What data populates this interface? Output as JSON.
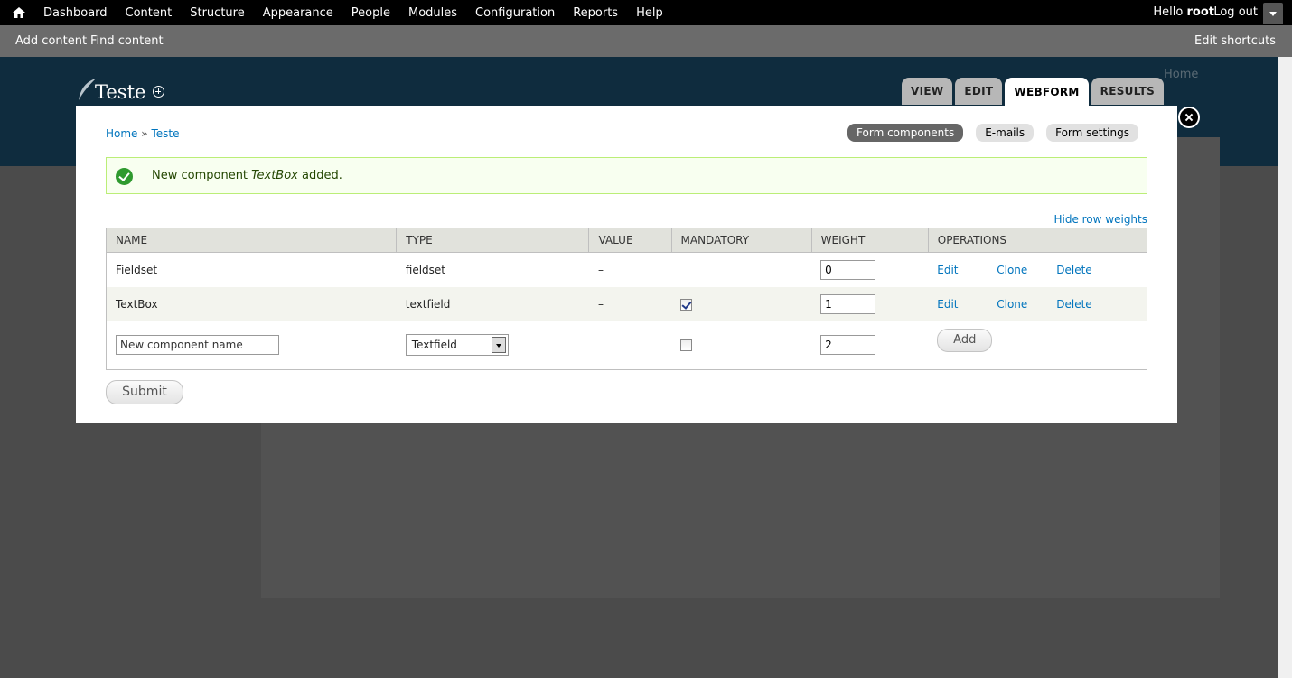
{
  "toolbar": {
    "menu": [
      "Dashboard",
      "Content",
      "Structure",
      "Appearance",
      "People",
      "Modules",
      "Configuration",
      "Reports",
      "Help"
    ],
    "hello": "Hello",
    "username": "root",
    "logout": "Log out"
  },
  "shortcuts": {
    "add_content": "Add content",
    "find_content": "Find content",
    "edit_shortcuts": "Edit shortcuts"
  },
  "site": {
    "title": "Teste",
    "home_link": "Home"
  },
  "tabs": [
    "VIEW",
    "EDIT",
    "WEBFORM",
    "RESULTS"
  ],
  "active_tab": "WEBFORM",
  "breadcrumb": {
    "home": "Home",
    "separator": "»",
    "current": "Teste"
  },
  "subtabs": [
    "Form components",
    "E-mails",
    "Form settings"
  ],
  "active_subtab": "Form components",
  "message": {
    "prefix": "New component",
    "component": "TextBox",
    "suffix": "added."
  },
  "hide_row_weights": "Hide row weights",
  "table": {
    "headers": [
      "NAME",
      "TYPE",
      "VALUE",
      "MANDATORY",
      "WEIGHT",
      "OPERATIONS"
    ],
    "rows": [
      {
        "name": "Fieldset",
        "type": "fieldset",
        "value": "–",
        "mandatory": false,
        "weight": "0",
        "ops": [
          "Edit",
          "Clone",
          "Delete"
        ]
      },
      {
        "name": "TextBox",
        "type": "textfield",
        "value": "–",
        "mandatory": true,
        "weight": "1",
        "ops": [
          "Edit",
          "Clone",
          "Delete"
        ]
      }
    ],
    "new_row": {
      "name_value": "New component name",
      "type_selected": "Textfield",
      "mandatory": false,
      "weight": "2",
      "add_label": "Add"
    }
  },
  "submit_label": "Submit"
}
